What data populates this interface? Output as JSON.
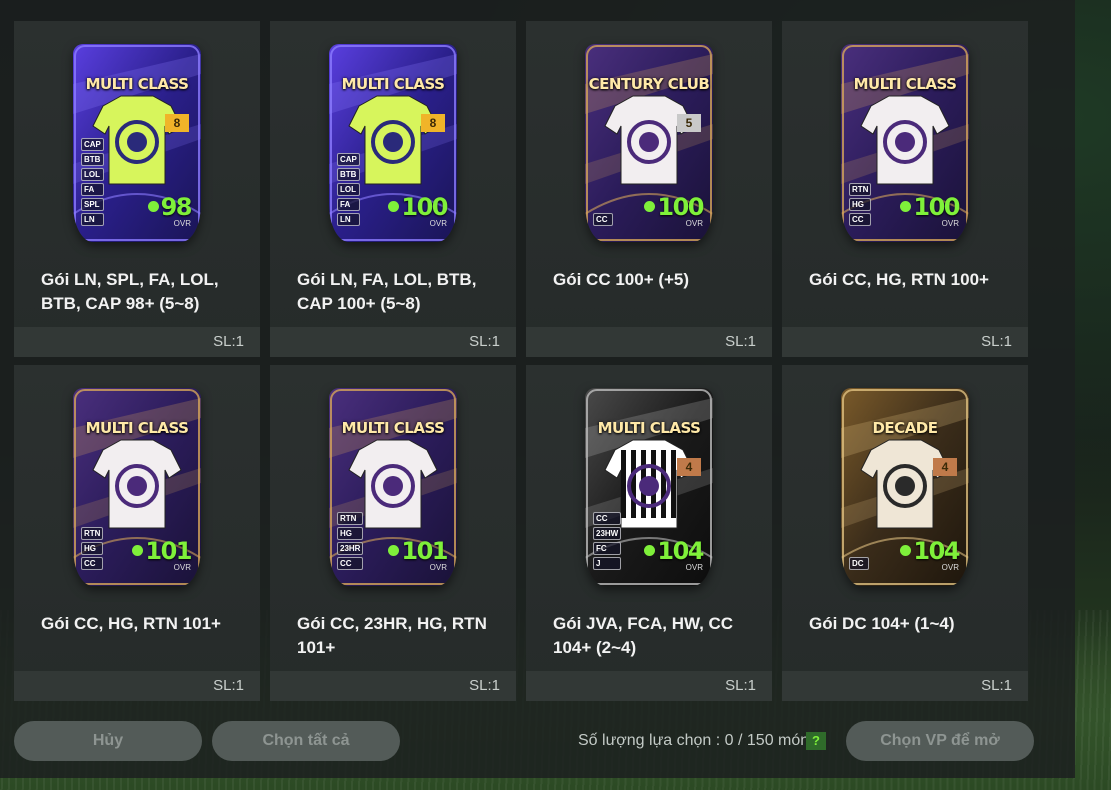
{
  "colors": {
    "accent_green": "#7ff03a",
    "panel_bg": "#1c201f",
    "card_bg": "#2b302f",
    "button_disabled": "#535b58"
  },
  "packs": [
    {
      "badge": "MULTI CLASS",
      "tier": "8",
      "ovr": "98",
      "ovr_label": "OVR",
      "tags": [
        "CAP",
        "BTB",
        "LOL",
        "FA",
        "SPL",
        "LN"
      ],
      "theme": "blue",
      "shirt": "lime",
      "name": "Gói LN, SPL, FA, LOL, BTB, CAP 98+ (5~8)",
      "qty": "SL:1"
    },
    {
      "badge": "MULTI CLASS",
      "tier": "8",
      "ovr": "100",
      "ovr_label": "OVR",
      "tags": [
        "CAP",
        "BTB",
        "LOL",
        "FA",
        "LN"
      ],
      "theme": "blue",
      "shirt": "lime",
      "name": "Gói LN, FA, LOL, BTB, CAP 100+ (5~8)",
      "qty": "SL:1"
    },
    {
      "badge": "CENTURY CLUB",
      "tier": "5",
      "ovr": "100",
      "ovr_label": "OVR",
      "tags": [
        "CC"
      ],
      "theme": "purple",
      "shirt": "white",
      "name": "Gói CC 100+ (+5)",
      "qty": "SL:1"
    },
    {
      "badge": "MULTI CLASS",
      "tier": "",
      "ovr": "100",
      "ovr_label": "OVR",
      "tags": [
        "RTN",
        "HG",
        "CC"
      ],
      "theme": "purple",
      "shirt": "white",
      "name": "Gói CC, HG, RTN 100+",
      "qty": "SL:1"
    },
    {
      "badge": "MULTI CLASS",
      "tier": "",
      "ovr": "101",
      "ovr_label": "OVR",
      "tags": [
        "RTN",
        "HG",
        "CC"
      ],
      "theme": "purple",
      "shirt": "white",
      "name": "Gói CC, HG, RTN 101+",
      "qty": "SL:1"
    },
    {
      "badge": "MULTI CLASS",
      "tier": "",
      "ovr": "101",
      "ovr_label": "OVR",
      "tags": [
        "RTN",
        "HG",
        "23HR",
        "CC"
      ],
      "theme": "purple",
      "shirt": "white",
      "name": "Gói CC, 23HR, HG, RTN 101+",
      "qty": "SL:1"
    },
    {
      "badge": "MULTI CLASS",
      "tier": "4",
      "ovr": "104",
      "ovr_label": "OVR",
      "tags": [
        "CC",
        "23HW",
        "FC",
        "J"
      ],
      "theme": "marble",
      "shirt": "juve",
      "name": "Gói JVA, FCA, HW, CC 104+ (2~4)",
      "qty": "SL:1"
    },
    {
      "badge": "DECADE",
      "tier": "4",
      "ovr": "104",
      "ovr_label": "OVR",
      "tags": [
        "DC"
      ],
      "theme": "gold",
      "shirt": "dc",
      "name": "Gói DC 104+ (1~4)",
      "qty": "SL:1"
    }
  ],
  "footer": {
    "cancel_label": "Hủy",
    "select_all_label": "Chọn tất cả",
    "selection_count": "Số lượng lựa chọn : 0 / 150 món",
    "help_label": "?",
    "open_label": "Chọn VP để mở"
  }
}
